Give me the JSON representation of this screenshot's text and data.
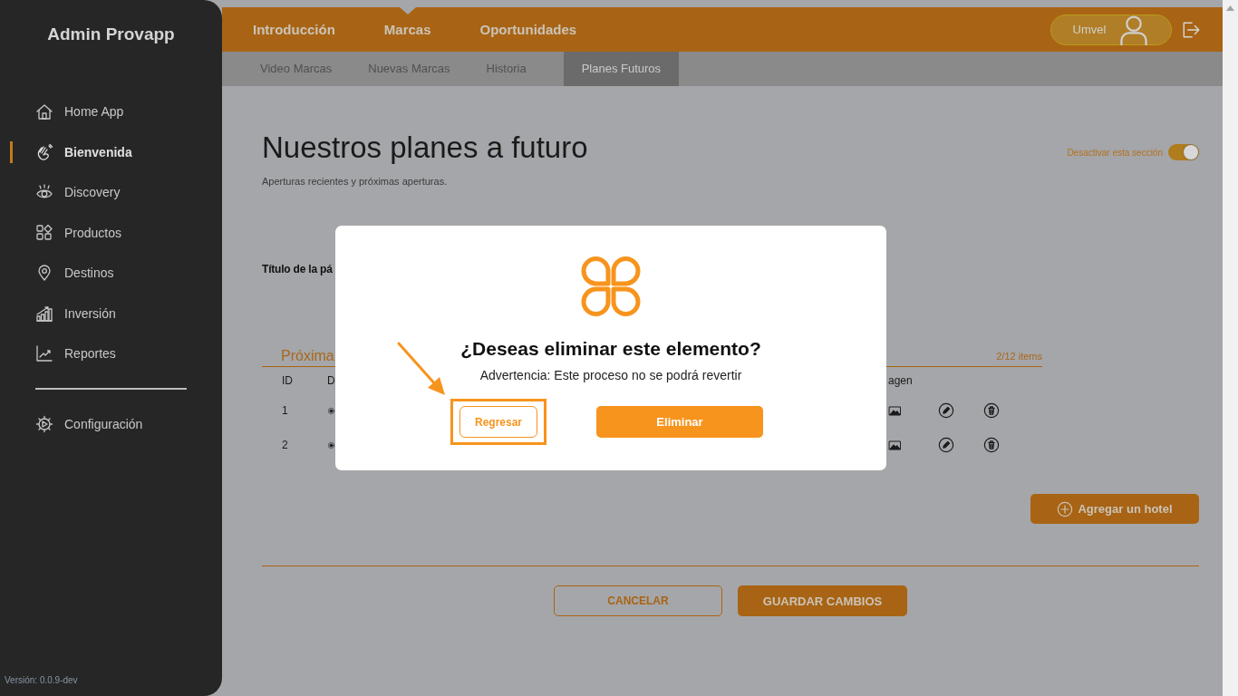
{
  "sidebar": {
    "title": "Admin Provapp",
    "items": [
      {
        "label": "Home App",
        "selected": false
      },
      {
        "label": "Bienvenida",
        "selected": true
      },
      {
        "label": "Discovery",
        "selected": false
      },
      {
        "label": "Productos",
        "selected": false
      },
      {
        "label": "Destinos",
        "selected": false
      },
      {
        "label": "Inversión",
        "selected": false
      },
      {
        "label": "Reportes",
        "selected": false
      }
    ],
    "footer_items": [
      {
        "label": "Configuración",
        "selected": false
      }
    ],
    "version": "Versión: 0.0.9-dev"
  },
  "top_nav": {
    "tabs": [
      {
        "label": "Introducción",
        "selected": false
      },
      {
        "label": "Marcas",
        "selected": true
      },
      {
        "label": "Oportunidades",
        "selected": false
      }
    ],
    "user": {
      "name": "Umvel"
    }
  },
  "sub_nav": {
    "tabs": [
      {
        "label": "Video Marcas",
        "selected": false
      },
      {
        "label": "Nuevas Marcas",
        "selected": false
      },
      {
        "label": "Historia",
        "selected": false
      },
      {
        "label": "Planes Futuros",
        "selected": true
      }
    ]
  },
  "page": {
    "title": "Nuestros planes a futuro",
    "subtitle": "Aperturas recientes y próximas aperturas.",
    "section_toggle": {
      "label": "Desactivar esta sección",
      "on": true
    },
    "field_label": "Título de la pá",
    "list": {
      "title": "Próxima",
      "count": "2/12 items",
      "columns": [
        "ID",
        "D",
        "agen"
      ],
      "rows": [
        {
          "id": "1"
        },
        {
          "id": "2"
        }
      ]
    },
    "add_button": "Agregar un hotel",
    "cancel_button": "CANCELAR",
    "save_button": "GUARDAR CAMBIOS"
  },
  "dialog": {
    "title": "¿Deseas eliminar este elemento?",
    "message": "Advertencia: Este proceso no se podrá revertir",
    "back_button": "Regresar",
    "delete_button": "Eliminar"
  }
}
